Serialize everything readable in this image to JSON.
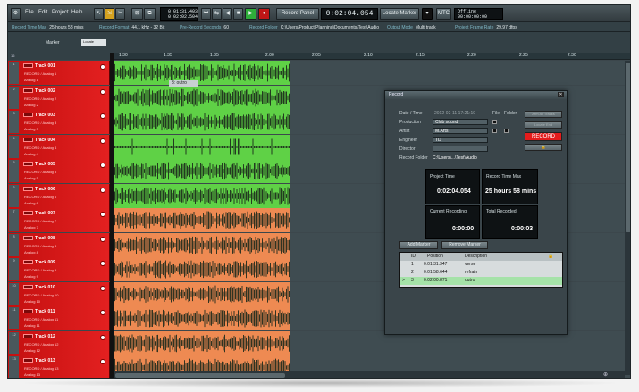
{
  "menu": [
    "File",
    "Edit",
    "Project",
    "Help"
  ],
  "toolbar": {
    "time1": "0:01:31.403",
    "time2": "0:02:02.504",
    "record_panel_label": "Record Panel",
    "main_time": "0:02:04.054",
    "locate_marker_label": "Locate Marker",
    "mtc_label": "MTC",
    "offline": "Offline",
    "offline_time": "00:00:00:00"
  },
  "info": [
    {
      "k": "Record Time Max",
      "v": "25 hours 58 mins"
    },
    {
      "k": "Record Format",
      "v": "44.1 kHz - 32 Bit"
    },
    {
      "k": "Pre-Record Seconds",
      "v": "60"
    },
    {
      "k": "Record Folder",
      "v": "C:\\Users\\Product Planning\\Documents\\Test\\Audio"
    },
    {
      "k": "Output Mode",
      "v": "Multi track"
    },
    {
      "k": "Project Frame Rate",
      "v": "29.97 dfps"
    }
  ],
  "marker_header": {
    "label": "Marker",
    "locate": "Locate"
  },
  "ruler_ticks": [
    "1:30",
    "1:35",
    "1:35",
    "2:00",
    "2:05",
    "2:10",
    "2:15",
    "2:20",
    "2:25",
    "2:30"
  ],
  "marker_flag": "3: outro",
  "tracks": [
    {
      "num": "1",
      "name": "Track 001",
      "sub1": "RECORD / Analog 1",
      "sub2": "Analog 1",
      "color": "green"
    },
    {
      "num": "2",
      "name": "Track 002",
      "sub1": "RECORD / Analog 2",
      "sub2": "Analog 2",
      "color": "green"
    },
    {
      "num": "3",
      "name": "Track 003",
      "sub1": "RECORD / Analog 3",
      "sub2": "Analog 3",
      "color": "green"
    },
    {
      "num": "4",
      "name": "Track 004",
      "sub1": "RECORD / Analog 4",
      "sub2": "Analog 4",
      "color": "green"
    },
    {
      "num": "5",
      "name": "Track 005",
      "sub1": "RECORD / Analog 5",
      "sub2": "Analog 5",
      "color": "green"
    },
    {
      "num": "6",
      "name": "Track 006",
      "sub1": "RECORD / Analog 6",
      "sub2": "Analog 6",
      "color": "green"
    },
    {
      "num": "7",
      "name": "Track 007",
      "sub1": "RECORD / Analog 7",
      "sub2": "Analog 7",
      "color": "orange"
    },
    {
      "num": "8",
      "name": "Track 008",
      "sub1": "RECORD / Analog 8",
      "sub2": "Analog 8",
      "color": "orange"
    },
    {
      "num": "9",
      "name": "Track 009",
      "sub1": "RECORD / Analog 9",
      "sub2": "Analog 9",
      "color": "orange"
    },
    {
      "num": "10",
      "name": "Track 010",
      "sub1": "RECORD / Analog 10",
      "sub2": "Analog 10",
      "color": "orange"
    },
    {
      "num": "11",
      "name": "Track 011",
      "sub1": "RECORD / Analog 11",
      "sub2": "Analog 11",
      "color": "orange"
    },
    {
      "num": "12",
      "name": "Track 012",
      "sub1": "RECORD / Analog 12",
      "sub2": "Analog 12",
      "color": "orange"
    },
    {
      "num": "13",
      "name": "Track 013",
      "sub1": "RECORD / Analog 13",
      "sub2": "Analog 13",
      "color": "orange"
    }
  ],
  "colors": {
    "green": "#5fd146",
    "orange": "#ee8a52",
    "record_red": "#e01818"
  },
  "dialog": {
    "title": "Record",
    "date_label": "Date / Time",
    "date_value": "2012-02-11 17:21:19",
    "file_label": "File",
    "folder_label": "Folder",
    "production_label": "Production",
    "production_value": "Club sound",
    "artist_label": "Artist",
    "artist_value": "M.Arts",
    "engineer_label": "Engineer",
    "engineer_value": "TD",
    "director_label": "Director",
    "director_value": "",
    "folder_row_label": "Record Folder",
    "folder_row_value": "C:\\Users\\...\\Test\\Audio",
    "arm_all": "Arm All Tracks",
    "locate_end": "Locate End",
    "record_btn": "RECORD",
    "project_time_label": "Project Time",
    "project_time": "0:02:04.054",
    "rec_max_label": "Record Time Max",
    "rec_max": "25 hours 58 mins",
    "current_label": "Current Recording",
    "current": "0:00:00",
    "total_label": "Total Recorded",
    "total": "0:00:03",
    "add_marker": "Add Marker",
    "remove_marker": "Remove Marker",
    "cols": [
      "ID",
      "Position",
      "Description"
    ],
    "markers": [
      {
        "id": "1",
        "pos": "0:01:31.347",
        "desc": "verse"
      },
      {
        "id": "2",
        "pos": "0:01:58.644",
        "desc": "refrain"
      },
      {
        "id": "3",
        "pos": "0:02:00.871",
        "desc": "outro"
      }
    ]
  }
}
